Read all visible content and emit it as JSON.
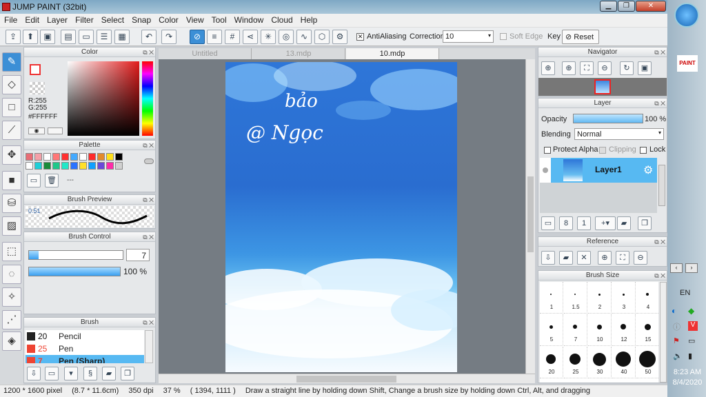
{
  "app": {
    "title": "JUMP PAINT (32bit)"
  },
  "menu": [
    "File",
    "Edit",
    "Layer",
    "Filter",
    "Select",
    "Snap",
    "Color",
    "View",
    "Tool",
    "Window",
    "Cloud",
    "Help"
  ],
  "toolbar": {
    "antialiasing_label": "AntiAliasing",
    "correction_label": "Correction",
    "correction_value": "10",
    "soft_edge_label": "Soft Edge",
    "key_label": "Key",
    "reset_label": "Reset"
  },
  "tabs": [
    "Untitled",
    "13.mdp",
    "10.mdp"
  ],
  "color_panel": {
    "title": "Color",
    "r": "R:255",
    "g": "G:255",
    "hex": "#FFFFFF"
  },
  "palette": {
    "title": "Palette",
    "colors": [
      "#e86d76",
      "#f4a0a8",
      "#ffffff",
      "#ff7777",
      "#ff3030",
      "#44aaff",
      "#ffffff",
      "#ff2b2b",
      "#e38a2b",
      "#ffe01a",
      "#000000",
      "#ffffff",
      "#1ecfd8",
      "#1a8a3a",
      "#1ec88a",
      "#22e8c8",
      "#2a73ff",
      "#ffe02a",
      "#0fa0ff",
      "#6a4ad8",
      "#ff2ba8",
      "#d0d0d0"
    ],
    "placeholder": "---"
  },
  "brush_preview": {
    "title": "Brush Preview",
    "size": "0.51"
  },
  "brush_control": {
    "title": "Brush Control",
    "size": "7",
    "opacity": "100 %",
    "opacity_fraction": 1.0,
    "size_fraction": 0.1
  },
  "brush_list": {
    "title": "Brush",
    "items": [
      {
        "size": "20",
        "name": "Pencil",
        "color": "#222"
      },
      {
        "size": "25",
        "name": "Pen",
        "color": "#e43"
      },
      {
        "size": "7",
        "name": "Pen (Sharp)",
        "color": "#e43"
      }
    ]
  },
  "navigator": {
    "title": "Navigator"
  },
  "layer_panel": {
    "title": "Layer",
    "opacity_label": "Opacity",
    "opacity_value": "100 %",
    "blending_label": "Blending",
    "blending_value": "Normal",
    "protect_alpha": "Protect Alpha",
    "clipping": "Clipping",
    "lock": "Lock",
    "layer_name": "Layer1"
  },
  "reference": {
    "title": "Reference"
  },
  "brush_size": {
    "title": "Brush Size",
    "rows": [
      [
        "1",
        "1.5",
        "2",
        "3",
        "4"
      ],
      [
        "5",
        "7",
        "10",
        "12",
        "15"
      ],
      [
        "20",
        "25",
        "30",
        "40",
        "50"
      ]
    ]
  },
  "canvas_text": [
    "bảo",
    "@ Ngọc"
  ],
  "status": {
    "size": "1200 * 1600 pixel",
    "cm": "(8.7 * 11.6cm)",
    "dpi": "350 dpi",
    "zoom": "37 %",
    "coords": "( 1394, 1111 )",
    "hint": "Draw a straight line by holding down Shift, Change a brush size by holding down Ctrl, Alt, and dragging"
  },
  "taskbar": {
    "lang": "EN",
    "time": "8:23 AM",
    "date": "8/4/2020"
  }
}
